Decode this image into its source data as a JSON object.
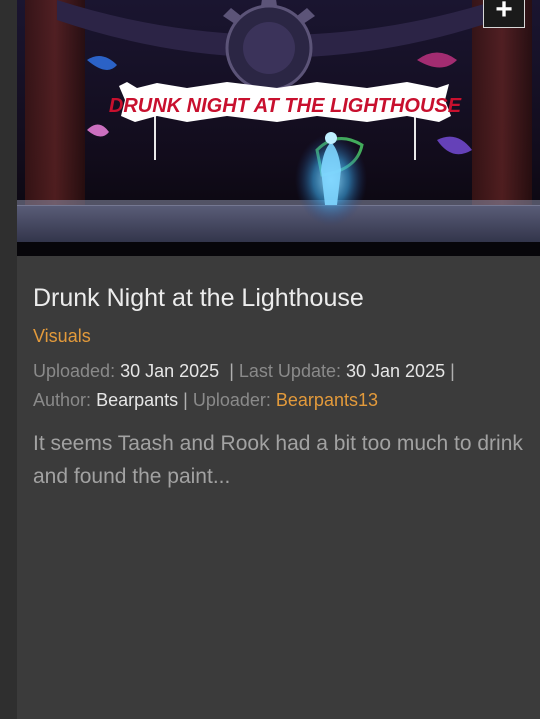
{
  "mod": {
    "thumbnail_banner": "DRUNK NIGHT AT THE LIGHTHOUSE",
    "add_button_icon": "plus-icon",
    "add_button_label": "+",
    "title": "Drunk Night at the Lighthouse",
    "category": "Visuals",
    "uploaded_label": "Uploaded:",
    "uploaded_date": "30 Jan 2025",
    "separator": "|",
    "last_update_label": "Last Update:",
    "last_update_date": "30 Jan 2025",
    "author_label": "Author:",
    "author": "Bearpants",
    "uploader_label": "Uploader:",
    "uploader": "Bearpants13",
    "description": "It seems Taash and Rook had a bit too much to drink and found the paint..."
  },
  "colors": {
    "accent": "#e39a3b",
    "card_bg": "#3b3b3b",
    "page_bg": "#2f2f2f",
    "title_text": "#ececec",
    "banner_red": "#c8102e"
  }
}
